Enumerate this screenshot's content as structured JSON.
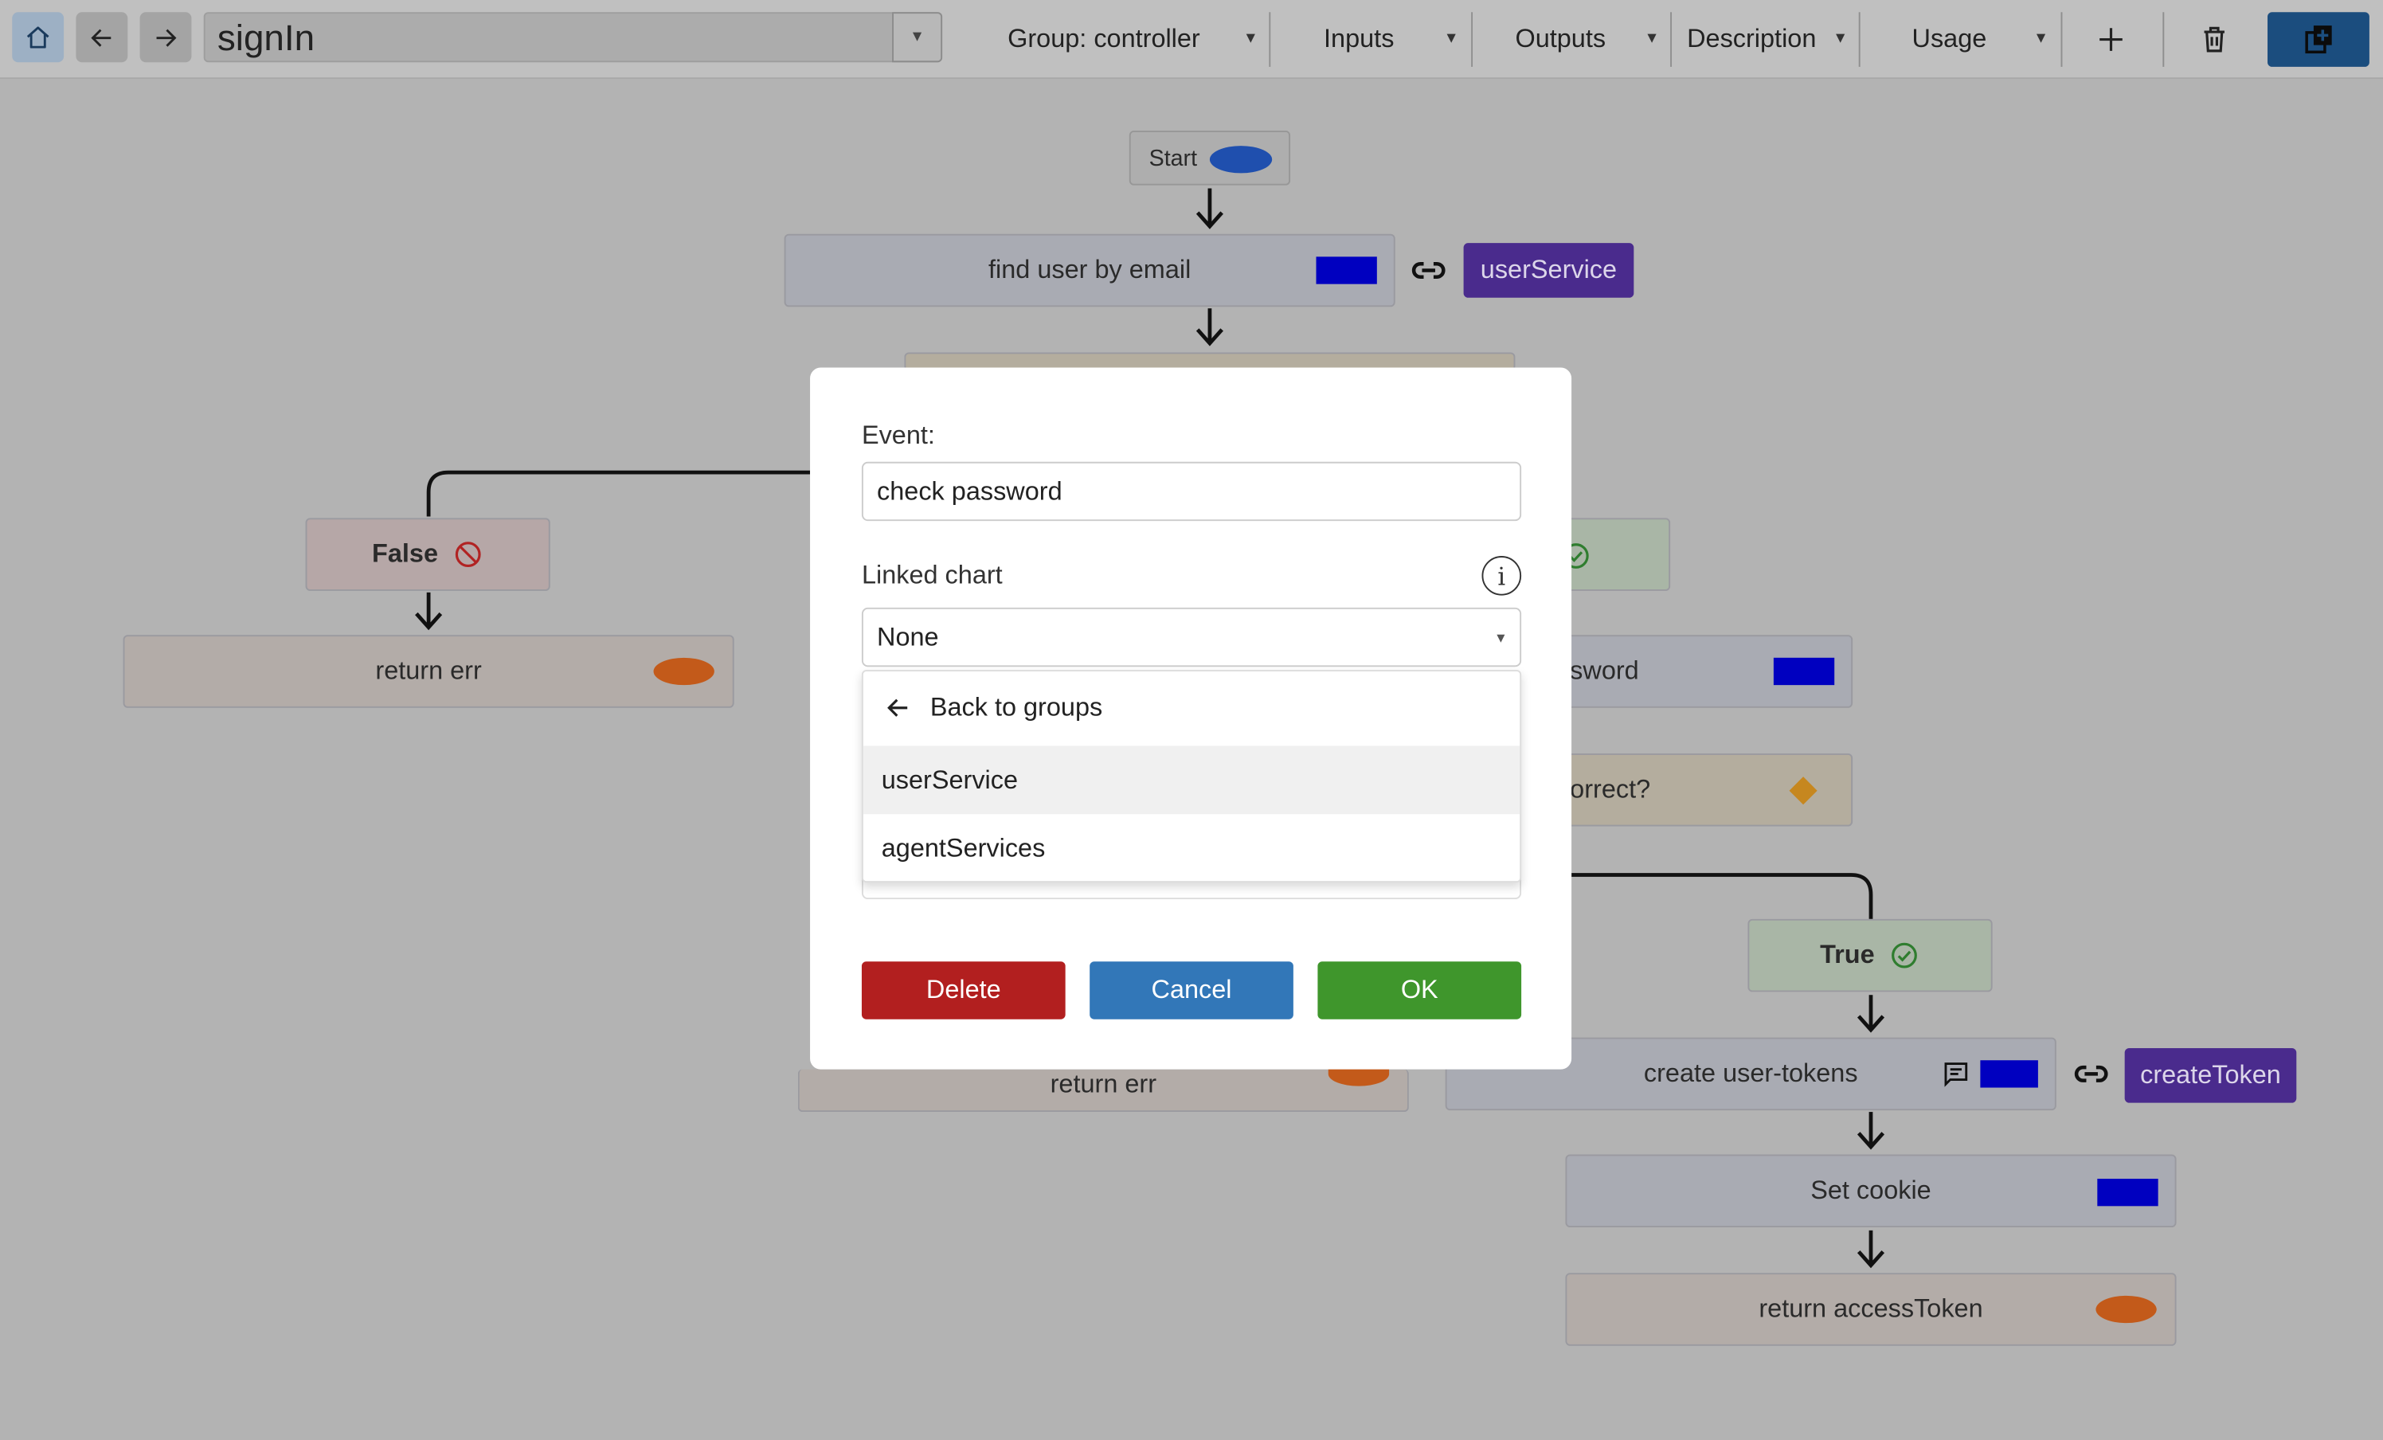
{
  "toolbar": {
    "chart_name": "signIn",
    "menus": {
      "group": "Group: controller",
      "inputs": "Inputs",
      "outputs": "Outputs",
      "description": "Description",
      "usage": "Usage"
    },
    "icons": [
      "home-icon",
      "back-arrow-icon",
      "forward-arrow-icon",
      "plus-icon",
      "trash-icon",
      "new-copy-icon"
    ]
  },
  "chart": {
    "start_label": "Start",
    "nodes": {
      "find_user": "find user by email",
      "find_user_link": "userService",
      "false_label": "False",
      "return_err_left": "return err",
      "password_partial": "sword",
      "correct_partial": "orrect?",
      "true_label": "True",
      "return_err_mid": "return err",
      "create_tokens": "create user-tokens",
      "create_tokens_link": "createToken",
      "set_cookie": "Set cookie",
      "return_token": "return accessToken"
    }
  },
  "modal": {
    "event_label": "Event:",
    "event_value": "check password",
    "linked_label": "Linked chart",
    "info_glyph": "i",
    "linked_value": "None",
    "dropdown": {
      "back_label": "Back to groups",
      "items": [
        "userService",
        "agentServices"
      ]
    },
    "buttons": {
      "delete": "Delete",
      "cancel": "Cancel",
      "ok": "OK"
    }
  },
  "colors": {
    "overlay": "#b3b3b3",
    "delete": "#b21f1f",
    "cancel": "#3277b8",
    "ok": "#3f962c",
    "link_tag": "#4a2b8d",
    "func_marker": "#0000c0",
    "return_marker": "#c35a1a"
  }
}
